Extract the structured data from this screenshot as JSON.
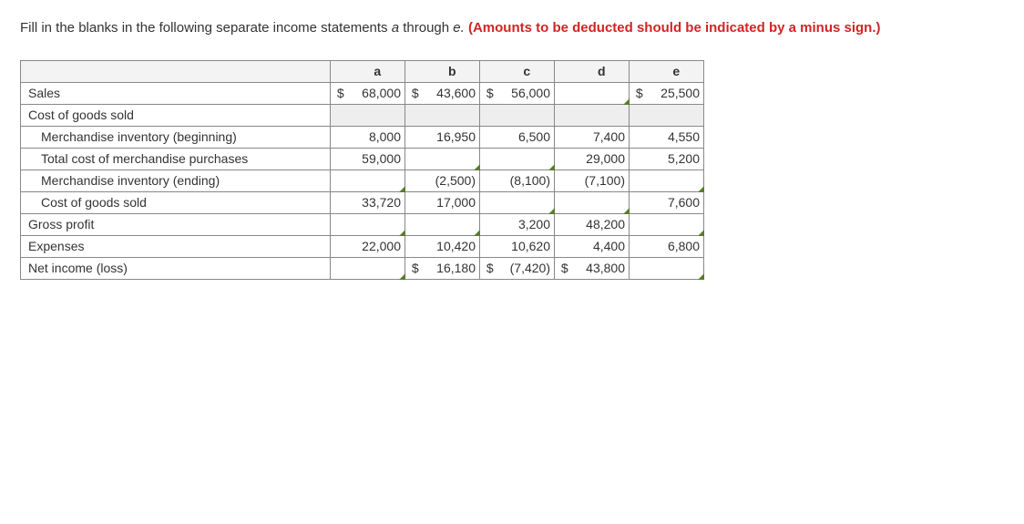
{
  "instruction": {
    "plain1": "Fill in the blanks in the following separate income statements ",
    "ital": "a",
    "plain2": " through ",
    "ital2": "e. ",
    "red": "(Amounts to be deducted should be indicated by a minus sign.)"
  },
  "headers": {
    "a": "a",
    "b": "b",
    "c": "c",
    "d": "d",
    "e": "e"
  },
  "rows": {
    "sales": {
      "label": "Sales"
    },
    "cogs_hdr": {
      "label": "Cost of goods sold"
    },
    "mi_beg": {
      "label": "Merchandise inventory (beginning)"
    },
    "purchases": {
      "label": "Total cost of merchandise purchases"
    },
    "mi_end": {
      "label": "Merchandise inventory (ending)"
    },
    "cogs": {
      "label": "Cost of goods sold"
    },
    "gross": {
      "label": "Gross profit"
    },
    "expenses": {
      "label": "Expenses"
    },
    "netincome": {
      "label": "Net income (loss)"
    }
  },
  "values": {
    "sales": {
      "a": {
        "s": "$",
        "v": "68,000"
      },
      "b": {
        "s": "$",
        "v": "43,600"
      },
      "c": {
        "s": "$",
        "v": "56,000"
      },
      "d": {
        "blank": true
      },
      "e": {
        "s": "$",
        "v": "25,500"
      }
    },
    "cogs_hdr": {
      "a": {
        "grey": true
      },
      "b": {
        "grey": true
      },
      "c": {
        "grey": true
      },
      "d": {
        "grey": true
      },
      "e": {
        "grey": true
      }
    },
    "mi_beg": {
      "a": {
        "v": "8,000"
      },
      "b": {
        "v": "16,950"
      },
      "c": {
        "v": "6,500"
      },
      "d": {
        "v": "7,400"
      },
      "e": {
        "v": "4,550"
      }
    },
    "purchases": {
      "a": {
        "v": "59,000"
      },
      "b": {
        "blank": true
      },
      "c": {
        "blank": true
      },
      "d": {
        "v": "29,000"
      },
      "e": {
        "v": "5,200"
      }
    },
    "mi_end": {
      "a": {
        "blank": true
      },
      "b": {
        "v": "(2,500)"
      },
      "c": {
        "v": "(8,100)"
      },
      "d": {
        "v": "(7,100)"
      },
      "e": {
        "blank": true
      }
    },
    "cogs": {
      "a": {
        "v": "33,720"
      },
      "b": {
        "v": "17,000"
      },
      "c": {
        "blank": true
      },
      "d": {
        "blank": true
      },
      "e": {
        "v": "7,600"
      }
    },
    "gross": {
      "a": {
        "blank": true
      },
      "b": {
        "blank": true
      },
      "c": {
        "v": "3,200"
      },
      "d": {
        "v": "48,200"
      },
      "e": {
        "blank": true
      }
    },
    "expenses": {
      "a": {
        "v": "22,000"
      },
      "b": {
        "v": "10,420"
      },
      "c": {
        "v": "10,620"
      },
      "d": {
        "v": "4,400"
      },
      "e": {
        "v": "6,800"
      }
    },
    "netincome": {
      "a": {
        "blank": true
      },
      "b": {
        "s": "$",
        "v": "16,180"
      },
      "c": {
        "s": "$",
        "v": "(7,420)"
      },
      "d": {
        "s": "$",
        "v": "43,800"
      },
      "e": {
        "blank": true
      }
    }
  },
  "chart_data": {
    "type": "table",
    "title": "Income statements a through e (fill-in-the-blank)",
    "columns": [
      "a",
      "b",
      "c",
      "d",
      "e"
    ],
    "data": {
      "Sales": [
        68000,
        43600,
        56000,
        null,
        25500
      ],
      "Merchandise inventory (beginning)": [
        8000,
        16950,
        6500,
        7400,
        4550
      ],
      "Total cost of merchandise purchases": [
        59000,
        null,
        null,
        29000,
        5200
      ],
      "Merchandise inventory (ending)": [
        null,
        -2500,
        -8100,
        -7100,
        null
      ],
      "Cost of goods sold": [
        33720,
        17000,
        null,
        null,
        7600
      ],
      "Gross profit": [
        null,
        null,
        3200,
        48200,
        null
      ],
      "Expenses": [
        22000,
        10420,
        10620,
        4400,
        6800
      ],
      "Net income (loss)": [
        null,
        16180,
        -7420,
        43800,
        null
      ]
    }
  }
}
